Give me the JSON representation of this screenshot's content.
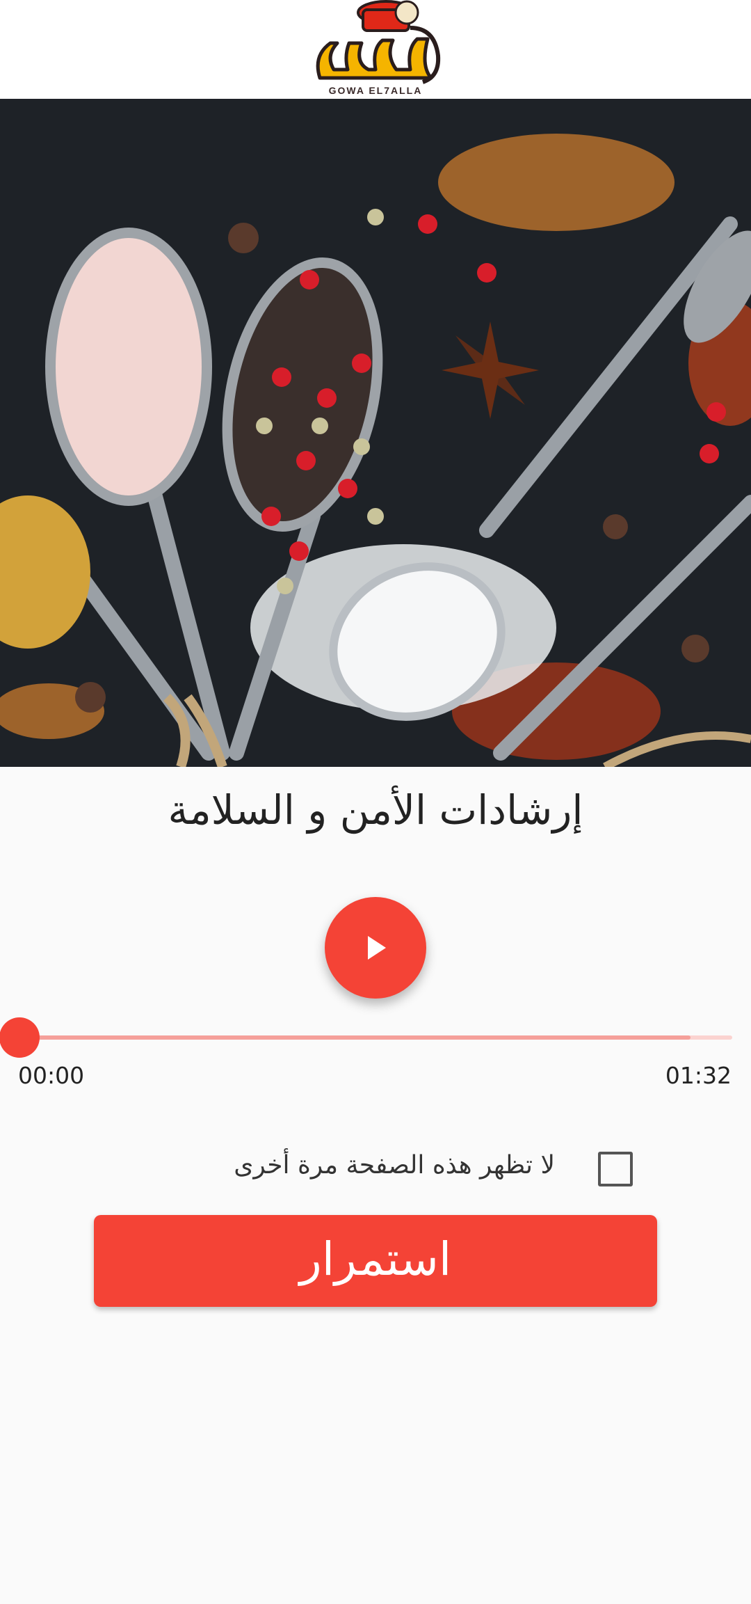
{
  "header": {
    "logo_caption": "GOWA EL7ALLA"
  },
  "main": {
    "title": "إرشادات الأمن و السلامة"
  },
  "player": {
    "current_time": "00:00",
    "total_time": "01:32",
    "progress": 0
  },
  "options": {
    "dont_show_label": "لا تظهر هذه الصفحة مرة أخرى",
    "dont_show_checked": false
  },
  "actions": {
    "continue_label": "استمرار"
  },
  "colors": {
    "accent": "#f44336",
    "logo_yellow": "#f5b400",
    "logo_red": "#e02818"
  },
  "icons": {
    "play": "play-icon",
    "checkbox": "checkbox-icon"
  }
}
